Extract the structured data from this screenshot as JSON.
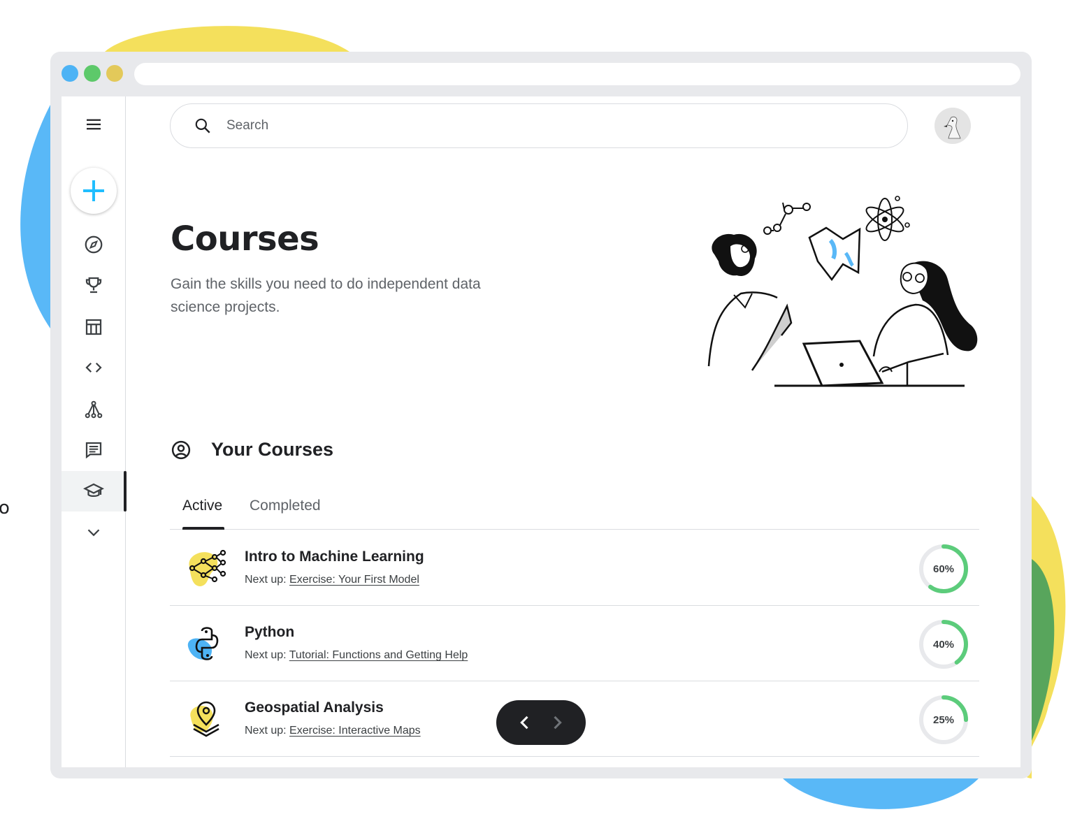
{
  "colors": {
    "accent_blue": "#20beff",
    "progress_green": "#5ccc7b",
    "blob_yellow": "#f4e05c",
    "blob_blue": "#59b8f7",
    "blob_green": "#58a55c",
    "dark": "#202124"
  },
  "window": {
    "traffic_lights": [
      "#4db3f5",
      "#5dc96a",
      "#e3c95a"
    ]
  },
  "sidebar": {
    "items": [
      {
        "name": "menu",
        "icon": "hamburger-menu-icon"
      },
      {
        "name": "create",
        "icon": "plus-icon"
      },
      {
        "name": "compass",
        "icon": "compass-icon"
      },
      {
        "name": "trophy",
        "icon": "trophy-icon"
      },
      {
        "name": "table",
        "icon": "table-icon"
      },
      {
        "name": "code",
        "icon": "code-icon"
      },
      {
        "name": "models",
        "icon": "model-network-icon"
      },
      {
        "name": "discussion",
        "icon": "discussion-icon"
      },
      {
        "name": "learn",
        "icon": "graduation-cap-icon",
        "active": true
      },
      {
        "name": "more",
        "icon": "chevron-down-icon"
      }
    ]
  },
  "search": {
    "placeholder": "Search",
    "value": ""
  },
  "header": {
    "title": "Courses",
    "description": "Gain the skills you need to do independent data science projects."
  },
  "your_courses": {
    "heading": "Your Courses",
    "tabs": [
      {
        "label": "Active",
        "selected": true
      },
      {
        "label": "Completed",
        "selected": false
      }
    ],
    "next_up_prefix": "Next up:",
    "courses": [
      {
        "title": "Intro to Machine Learning",
        "next_up": "Exercise: Your First Model",
        "progress": 60,
        "progress_label": "60%",
        "icon": "machine-learning-icon",
        "icon_bg": "#f4e05c"
      },
      {
        "title": "Python",
        "next_up": "Tutorial: Functions and Getting Help",
        "progress": 40,
        "progress_label": "40%",
        "icon": "python-icon",
        "icon_bg": "#4db3f5"
      },
      {
        "title": "Geospatial Analysis",
        "next_up": "Exercise: Interactive Maps",
        "progress": 25,
        "progress_label": "25%",
        "icon": "location-pin-icon",
        "icon_bg": "#f4e05c"
      }
    ]
  },
  "pager": {
    "prev_icon": "chevron-left-icon",
    "next_icon": "chevron-right-icon",
    "next_enabled": false
  },
  "stray_text": "o"
}
